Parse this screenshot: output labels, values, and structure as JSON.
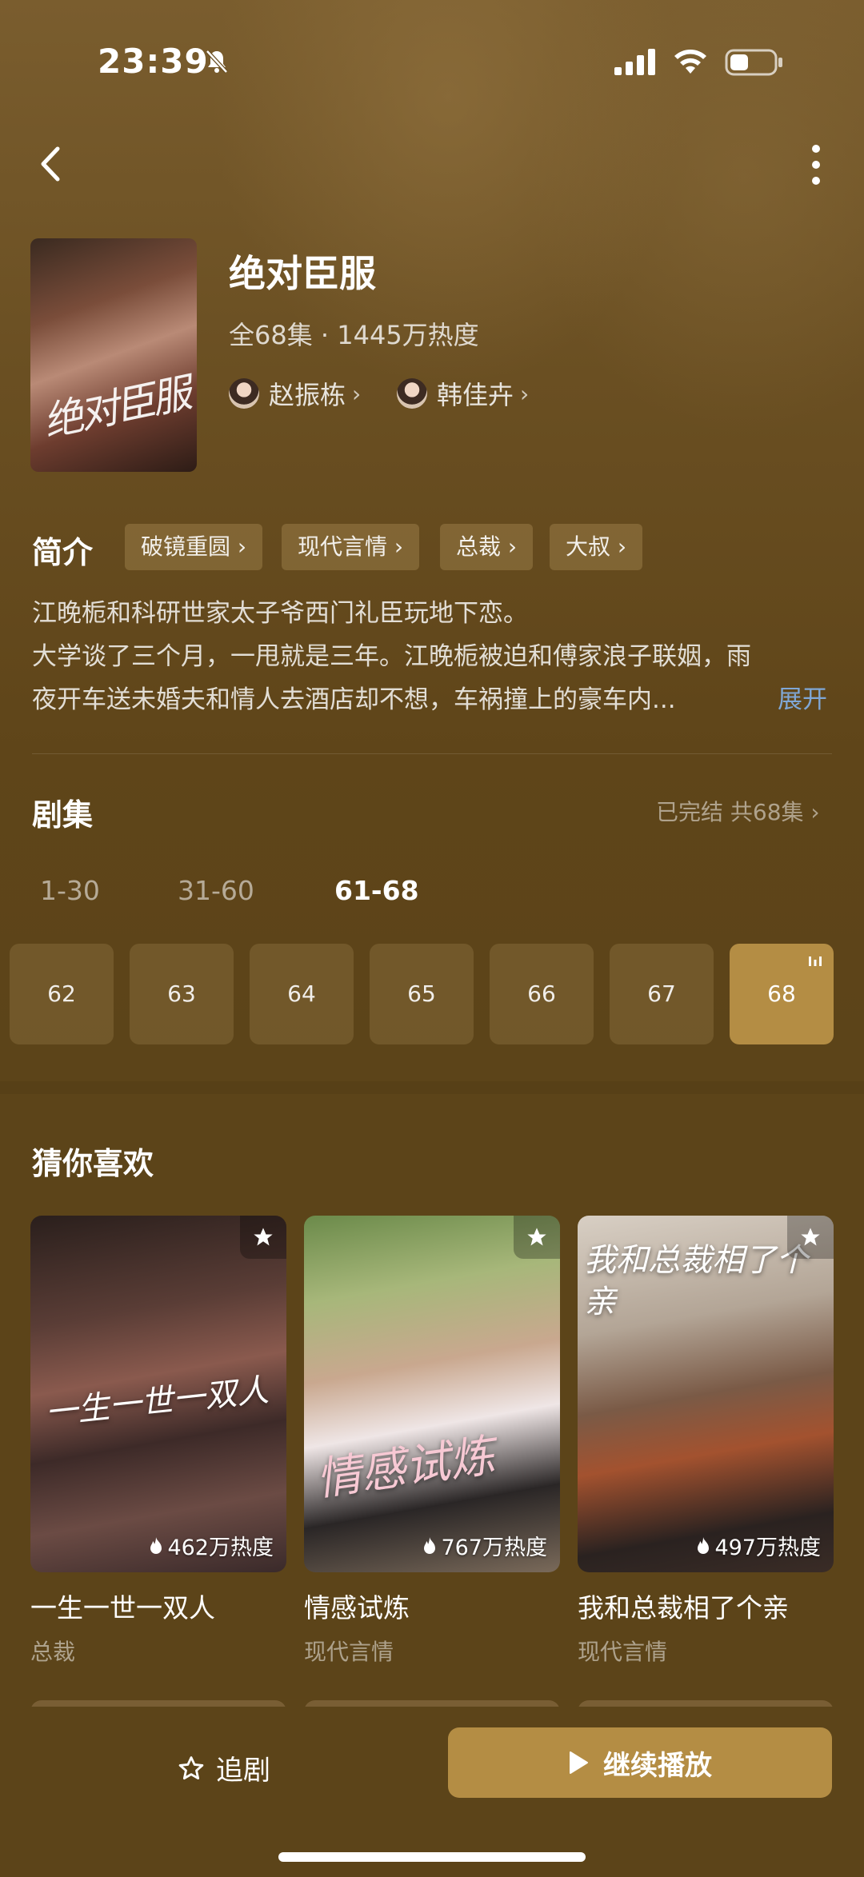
{
  "status_bar": {
    "time": "23:39"
  },
  "drama": {
    "title": "绝对臣服",
    "meta": "全68集 · 1445万热度",
    "poster_calligraphy": "绝对臣服",
    "actors": [
      {
        "name": "赵振栋"
      },
      {
        "name": "韩佳卉"
      }
    ]
  },
  "intro": {
    "label": "简介",
    "tags": [
      "破镜重圆",
      "现代言情",
      "总裁",
      "大叔"
    ],
    "lines": [
      "江晚栀和科研世家太子爷西门礼臣玩地下恋。",
      "大学谈了三个月，一甩就是三年。江晚栀被迫和傅家浪子联姻，雨",
      "夜开车送未婚夫和情人去酒店却不想，车祸撞上的豪车内..."
    ],
    "expand_label": "展开"
  },
  "episodes": {
    "title": "剧集",
    "status": "已完结 共68集 ›",
    "ranges": [
      "1-30",
      "31-60",
      "61-68"
    ],
    "active_range": "61-68",
    "items": [
      "62",
      "63",
      "64",
      "65",
      "66",
      "67",
      "68"
    ],
    "current": "68"
  },
  "recommend": {
    "title": "猜你喜欢",
    "cards": [
      {
        "name": "一生一世一双人",
        "category": "总裁",
        "heat": "462万热度",
        "poster_text": "一生一世一双人"
      },
      {
        "name": "情感试炼",
        "category": "现代言情",
        "heat": "767万热度",
        "poster_text": "情感试炼"
      },
      {
        "name": "我和总裁相了个亲",
        "category": "现代言情",
        "heat": "497万热度",
        "poster_text": "我和总裁相了个亲"
      }
    ]
  },
  "bottom": {
    "follow_label": "追剧",
    "play_label": "继续播放"
  },
  "colors": {
    "accent": "#b48d44",
    "background": "#5c4419",
    "link": "#7fa7d6"
  }
}
